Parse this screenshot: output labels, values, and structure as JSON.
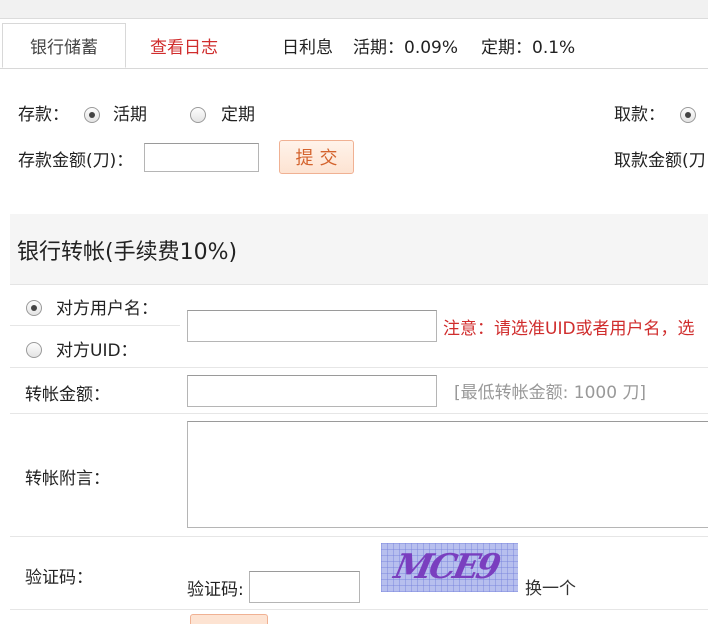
{
  "tabs": {
    "active": "银行储蓄",
    "log_link": "查看日志"
  },
  "interest": {
    "label": "日利息",
    "current_label": "活期：0.09%",
    "fixed_label": "定期：0.1%"
  },
  "deposit": {
    "label": "存款：",
    "option_current": "活期",
    "option_fixed": "定期",
    "selected": "活期",
    "amount_label": "存款金额(刀)：",
    "amount_value": "",
    "submit_label": "提交"
  },
  "withdraw": {
    "label": "取款：",
    "amount_label": "取款金额(刀"
  },
  "transfer": {
    "title": "银行转帐(手续费10%)",
    "recipient_username_label": "对方用户名：",
    "recipient_uid_label": "对方UID：",
    "recipient_selected": "对方用户名",
    "recipient_value": "",
    "recipient_note": "注意：请选准UID或者用户名，选",
    "amount_label": "转帐金额：",
    "amount_value": "",
    "amount_note": "[最低转帐金额: 1000 刀]",
    "message_label": "转帐附言：",
    "message_value": "",
    "captcha_row_label": "验证码：",
    "captcha_input_label": "验证码:",
    "captcha_value": "",
    "captcha_image_text": "MCE9",
    "refresh_label": "换一个"
  },
  "colors": {
    "link_red": "#d02d2d",
    "button_orange": "#d4632d",
    "captcha_bg": "#b7bfee",
    "captcha_text": "#7a3fbf"
  }
}
